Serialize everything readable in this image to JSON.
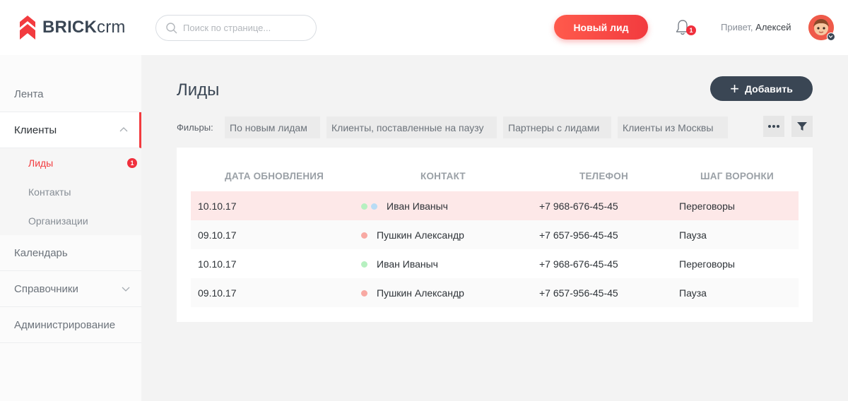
{
  "brand": {
    "name_bold": "BRICK",
    "name_light": "crm",
    "accent": "#f23b3f",
    "dark": "#3a4654"
  },
  "search": {
    "placeholder": "Поиск по странице..."
  },
  "header": {
    "new_lead_label": "Новый лид",
    "notifications_count": "1",
    "greeting": "Привет,",
    "user_name": "Алексей"
  },
  "sidebar": {
    "items": [
      {
        "label": "Лента"
      },
      {
        "label": "Клиенты"
      },
      {
        "label": "Календарь"
      },
      {
        "label": "Справочники"
      },
      {
        "label": "Администрирование"
      }
    ],
    "sub_items": [
      {
        "label": "Лиды",
        "badge": "1"
      },
      {
        "label": "Контакты"
      },
      {
        "label": "Организации"
      }
    ]
  },
  "main": {
    "title": "Лиды",
    "add_label": "Добавить",
    "filters_label": "Фильры:",
    "filters": [
      "По новым лидам",
      "Клиенты, поставленные на паузу",
      "Партнеры с лидами",
      "Клиенты из Москвы"
    ],
    "table": {
      "headers": [
        "ДАТА ОБНОВЛЕНИЯ",
        "КОНТАКТ",
        "ТЕЛЕФОН",
        "ШАГ ВОРОНКИ"
      ],
      "rows": [
        {
          "date": "10.10.17",
          "contact": "Иван Иваныч",
          "phone": "+7 968-676-45-45",
          "stage": "Переговоры",
          "dots": [
            "#b6f0c0",
            "#b8dcf5"
          ],
          "highlighted": true
        },
        {
          "date": "09.10.17",
          "contact": "Пушкин Александр",
          "phone": "+7 657-956-45-45",
          "stage": "Пауза",
          "dots": [
            "#f8a9a3"
          ],
          "highlighted": false
        },
        {
          "date": "10.10.17",
          "contact": "Иван Иваныч",
          "phone": "+7 968-676-45-45",
          "stage": "Переговоры",
          "dots": [
            "#b6f0c0"
          ],
          "highlighted": false
        },
        {
          "date": "09.10.17",
          "contact": "Пушкин Александр",
          "phone": "+7 657-956-45-45",
          "stage": "Пауза",
          "dots": [
            "#f8a9a3"
          ],
          "highlighted": false
        }
      ]
    }
  }
}
